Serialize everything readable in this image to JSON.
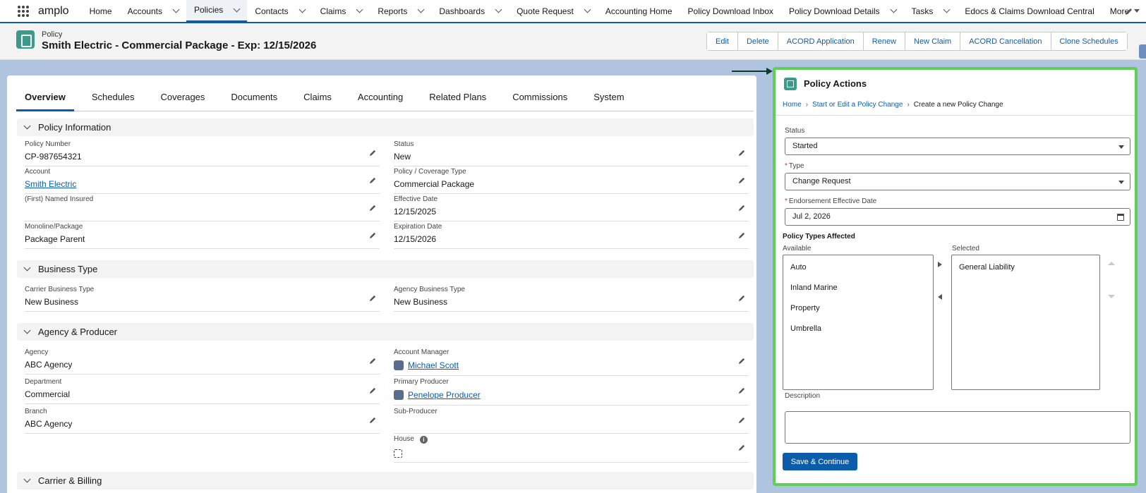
{
  "app": {
    "name": "amplo"
  },
  "nav": [
    {
      "label": "Home",
      "chevron": false
    },
    {
      "label": "Accounts",
      "chevron": true
    },
    {
      "label": "Policies",
      "chevron": true,
      "active": true
    },
    {
      "label": "Contacts",
      "chevron": true
    },
    {
      "label": "Claims",
      "chevron": true
    },
    {
      "label": "Reports",
      "chevron": true
    },
    {
      "label": "Dashboards",
      "chevron": true
    },
    {
      "label": "Quote Request",
      "chevron": true
    },
    {
      "label": "Accounting Home",
      "chevron": false
    },
    {
      "label": "Policy Download Inbox",
      "chevron": false
    },
    {
      "label": "Policy Download Details",
      "chevron": true
    },
    {
      "label": "Tasks",
      "chevron": true
    },
    {
      "label": "Edocs & Claims Download Central",
      "chevron": false
    },
    {
      "label": "More",
      "chevron": false
    }
  ],
  "record": {
    "object_label": "Policy",
    "title": "Smith Electric - Commercial Package - Exp: 12/15/2026",
    "actions": [
      "Edit",
      "Delete",
      "ACORD Application",
      "Renew",
      "New Claim",
      "ACORD Cancellation",
      "Clone Schedules"
    ]
  },
  "tabs": [
    "Overview",
    "Schedules",
    "Coverages",
    "Documents",
    "Claims",
    "Accounting",
    "Related Plans",
    "Commissions",
    "System"
  ],
  "sections": {
    "policy_info": {
      "title": "Policy Information",
      "policy_number_label": "Policy Number",
      "policy_number": "CP-987654321",
      "status_label": "Status",
      "status": "New",
      "account_label": "Account",
      "account": "Smith Electric",
      "coverage_type_label": "Policy / Coverage Type",
      "coverage_type": "Commercial Package",
      "named_insured_label": "(First) Named Insured",
      "named_insured": "",
      "effective_date_label": "Effective Date",
      "effective_date": "12/15/2025",
      "monoline_label": "Monoline/Package",
      "monoline": "Package Parent",
      "expiration_date_label": "Expiration Date",
      "expiration_date": "12/15/2026"
    },
    "business_type": {
      "title": "Business Type",
      "carrier_label": "Carrier Business Type",
      "carrier": "New Business",
      "agency_label": "Agency Business Type",
      "agency": "New Business"
    },
    "agency_producer": {
      "title": "Agency & Producer",
      "agency_label": "Agency",
      "agency": "ABC Agency",
      "account_manager_label": "Account Manager",
      "account_manager": "Michael Scott",
      "department_label": "Department",
      "department": "Commercial",
      "primary_producer_label": "Primary Producer",
      "primary_producer": "Penelope Producer",
      "branch_label": "Branch",
      "branch": "ABC Agency",
      "sub_producer_label": "Sub-Producer",
      "sub_producer": "",
      "house_label": "House"
    },
    "carrier_billing": {
      "title": "Carrier & Billing"
    }
  },
  "panel": {
    "title": "Policy Actions",
    "breadcrumbs": {
      "home": "Home",
      "start": "Start or Edit a Policy Change",
      "current": "Create a new Policy Change"
    },
    "status_label": "Status",
    "status_value": "Started",
    "type_label": "Type",
    "type_value": "Change Request",
    "eff_date_label": "Endorsement Effective Date",
    "eff_date_value": "Jul 2, 2026",
    "affected_label": "Policy Types Affected",
    "available_label": "Available",
    "available": [
      "Auto",
      "Inland Marine",
      "Property",
      "Umbrella"
    ],
    "selected_label": "Selected",
    "selected": [
      "General Liability"
    ],
    "description_label": "Description",
    "save_label": "Save & Continue"
  },
  "icons": {
    "app_launcher": "waffle-icon",
    "edit": "pencil-icon",
    "record": "policy-icon",
    "user": "user-icon",
    "info": "info-icon",
    "calendar": "calendar-icon"
  },
  "colors": {
    "brand": "#0b5cab",
    "highlight": "#5fcf55",
    "record_icon": "#3c9a8a"
  }
}
